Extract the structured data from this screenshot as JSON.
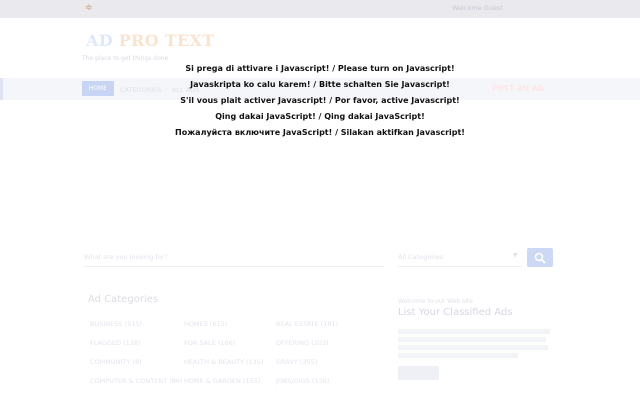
{
  "topbar": {
    "rss_icon": "rss-icon",
    "link": "Welcome Guest"
  },
  "logo": {
    "part1": "AD",
    "part2": "PRO TEXT"
  },
  "tagline": "The place to get things done",
  "nav": {
    "home": "HOME",
    "items": [
      "CATEGORIES",
      "ALL ADS"
    ],
    "post_ad": "POST AN AD"
  },
  "notices": [
    "Si prega di attivare i Javascript! / Please turn on Javascript!",
    "Javaskripta ko calu karem! / Bitte schalten Sie Javascript!",
    "S'il vous plait activer Javascript! / Por favor, active Javascript!",
    "Qing dakai JavaScript! / Qing dakai JavaScript!",
    "Пожалуйста включите JavaScript! / Silakan aktifkan Javascript!"
  ],
  "search": {
    "placeholder": "What are you looking for?",
    "category": "All Categories",
    "button_icon": "search-icon"
  },
  "categories": {
    "title": "Ad Categories",
    "items": [
      "BUSINESS (515)",
      "HOMES (615)",
      "REAL ESTATE (181)",
      "FLAGGED (128)",
      "FOR SALE (166)",
      "OFFERING (203)",
      "COMMUNITY (8)",
      "HEALTH & BEAUTY (135)",
      "GRAVY (355)",
      "COMPUTER & CONTENT (86)",
      "HOME & GARDEN (155)",
      "JOBS/GIGS (136)"
    ]
  },
  "promo": {
    "welcome": "Welcome to our Web site",
    "title": "List Your Classified Ads"
  }
}
